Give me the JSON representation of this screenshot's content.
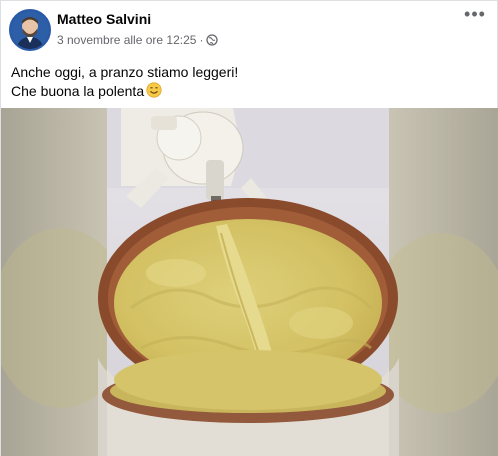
{
  "post": {
    "author": "Matteo Salvini",
    "timestamp": "3 novembre alle ore 12:25",
    "separator": "·",
    "more_label": "•••",
    "text_line1": "Anche oggi, a pranzo stiamo leggeri!",
    "text_line2": "Che buona la polenta"
  },
  "icons": {
    "privacy": "globe-icon",
    "emoji": "smiling-face-icon",
    "more": "more-options-icon"
  },
  "colors": {
    "author": "#050505",
    "meta": "#65676b",
    "polenta": "#d8c66a",
    "pot_rim": "#8a4a2c"
  }
}
